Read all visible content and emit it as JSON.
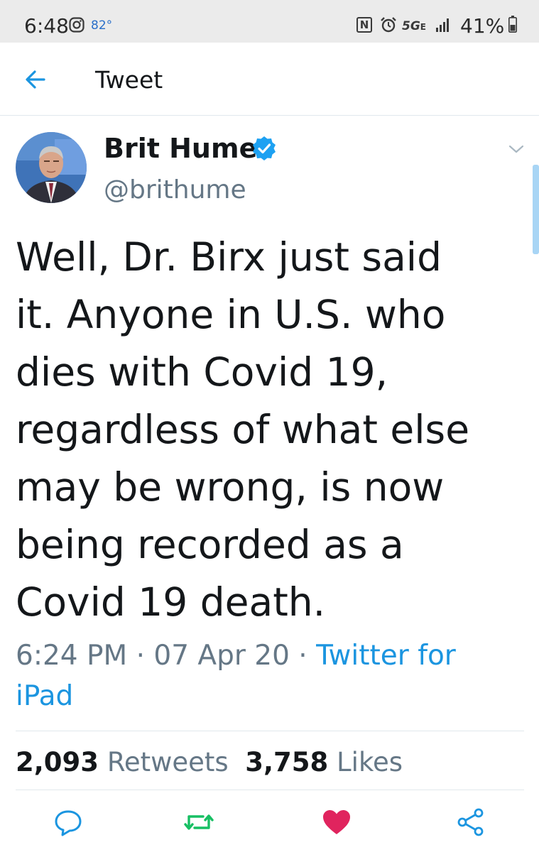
{
  "status_bar": {
    "time": "6:48",
    "temperature": "82°",
    "nfc_label": "N",
    "network": "5G",
    "network_sub": "E",
    "battery": "41%"
  },
  "header": {
    "title": "Tweet"
  },
  "tweet": {
    "display_name": "Brit Hume",
    "username": "@brithume",
    "text_lines": [
      "Well, Dr. Birx just said",
      "it. Anyone in U.S. who",
      "dies with Covid 19,",
      "regardless of what else",
      "may be wrong, is now",
      "being recorded as a",
      "Covid 19 death."
    ],
    "time": "6:24 PM",
    "date": "07 Apr 20",
    "separator": "·",
    "source_part1": "Twitter for",
    "source_part2": "iPad",
    "retweets_count": "2,093",
    "retweets_label": "Retweets",
    "likes_count": "3,758",
    "likes_label": "Likes"
  },
  "colors": {
    "accent": "#1b95e0",
    "secondary_text": "#657786",
    "retweet_green": "#17bf63",
    "like_red": "#e0245e",
    "verified_blue": "#1da1f2"
  },
  "icons": {
    "back": "back-arrow-icon",
    "verified": "verified-badge-icon",
    "menu": "chevron-down-icon",
    "reply": "reply-icon",
    "retweet": "retweet-icon",
    "like": "heart-icon",
    "share": "share-icon"
  }
}
